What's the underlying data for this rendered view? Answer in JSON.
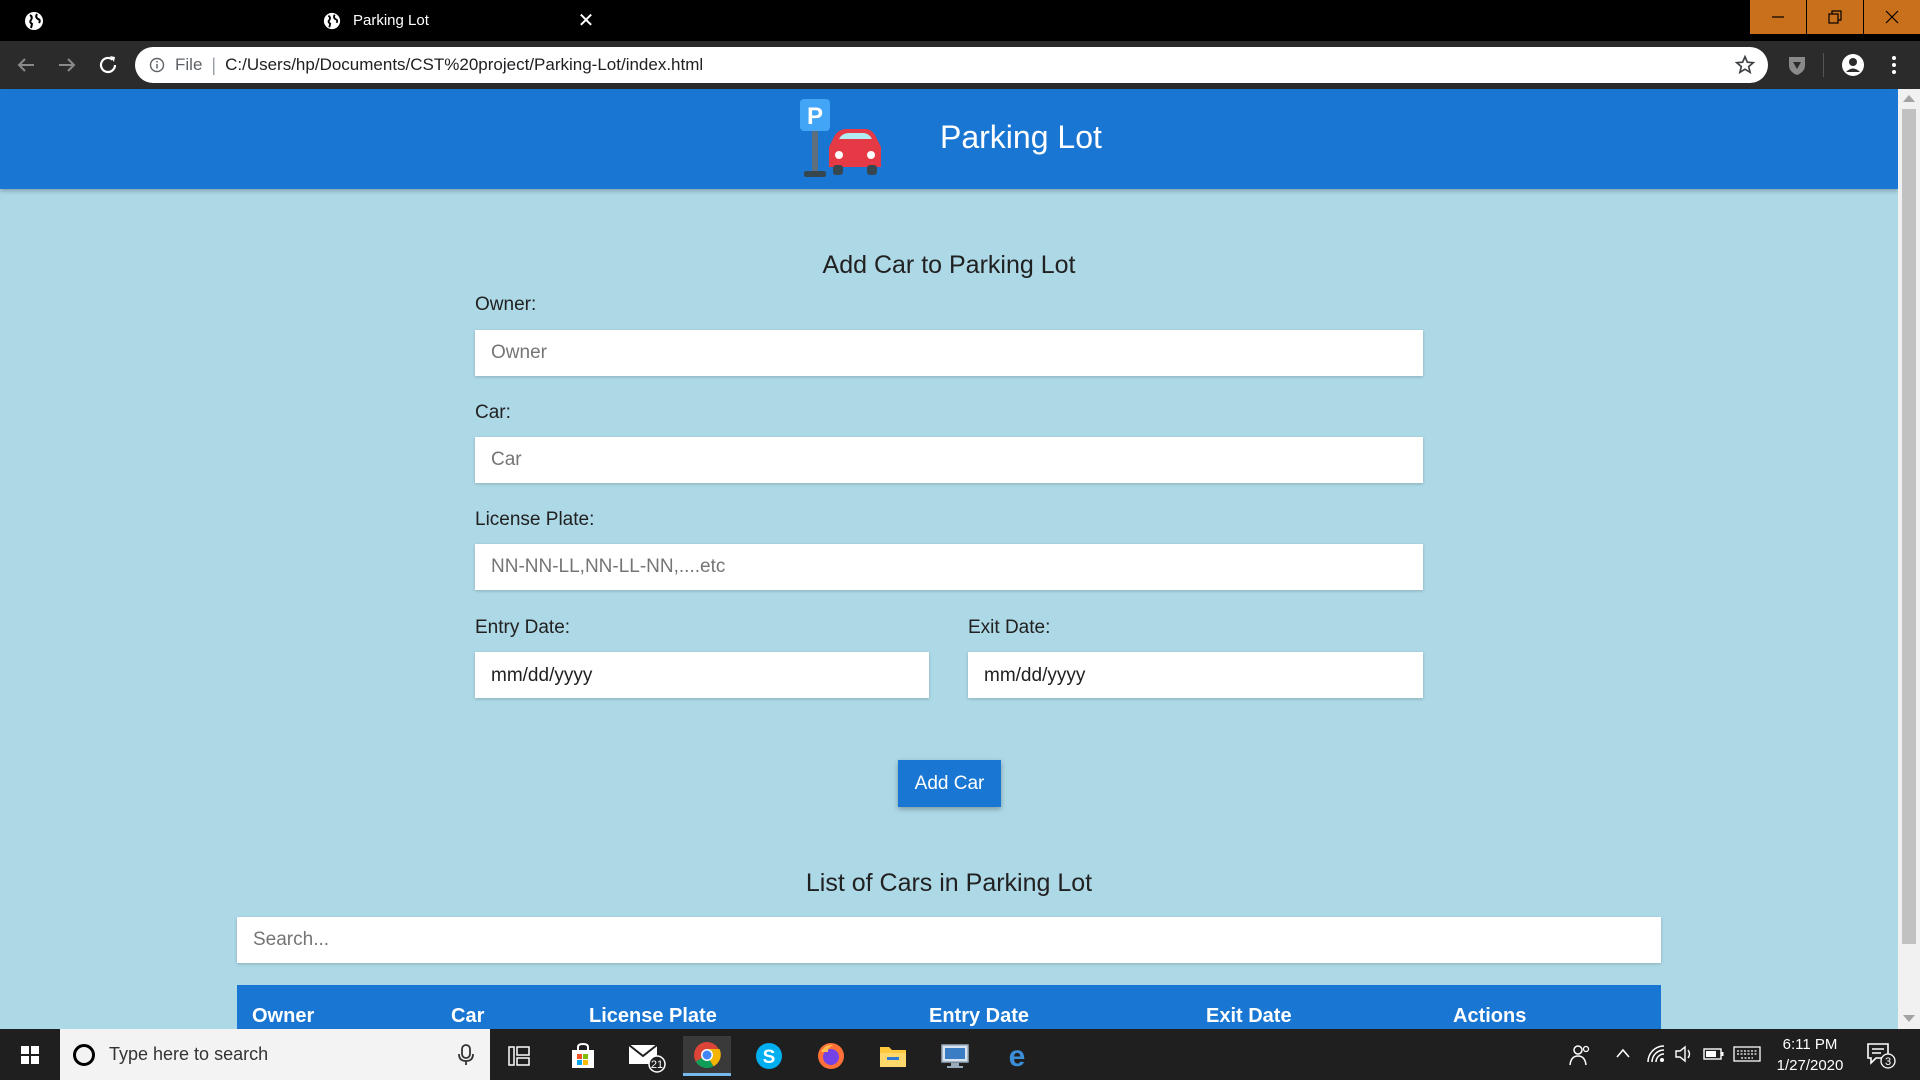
{
  "browser": {
    "tab_title": "Parking Lot",
    "tab_close_glyph": "✕",
    "address_scheme_label": "File",
    "address_separator": "|",
    "url": "C:/Users/hp/Documents/CST%20project/Parking-Lot/index.html"
  },
  "header": {
    "title": "Parking Lot",
    "logo_letter": "P"
  },
  "form": {
    "title": "Add Car to Parking Lot",
    "owner": {
      "label": "Owner:",
      "placeholder": "Owner"
    },
    "car": {
      "label": "Car:",
      "placeholder": "Car"
    },
    "license_plate": {
      "label": "License Plate:",
      "placeholder": "NN-NN-LL,NN-LL-NN,....etc"
    },
    "entry_date": {
      "label": "Entry Date:",
      "value": "mm/dd/yyyy"
    },
    "exit_date": {
      "label": "Exit Date:",
      "value": "mm/dd/yyyy"
    },
    "submit_label": "Add Car"
  },
  "list": {
    "title": "List of Cars in Parking Lot",
    "search_placeholder": "Search...",
    "columns": [
      "Owner",
      "Car",
      "License Plate",
      "Entry Date",
      "Exit Date",
      "Actions"
    ]
  },
  "taskbar": {
    "search_placeholder": "Type here to search",
    "mail_badge": "21",
    "time": "6:11 PM",
    "date": "1/27/2020",
    "notification_count": "3"
  },
  "colors": {
    "brand": "#1976d2",
    "page_background": "#add8e6",
    "window_controls": "#c8701c"
  }
}
